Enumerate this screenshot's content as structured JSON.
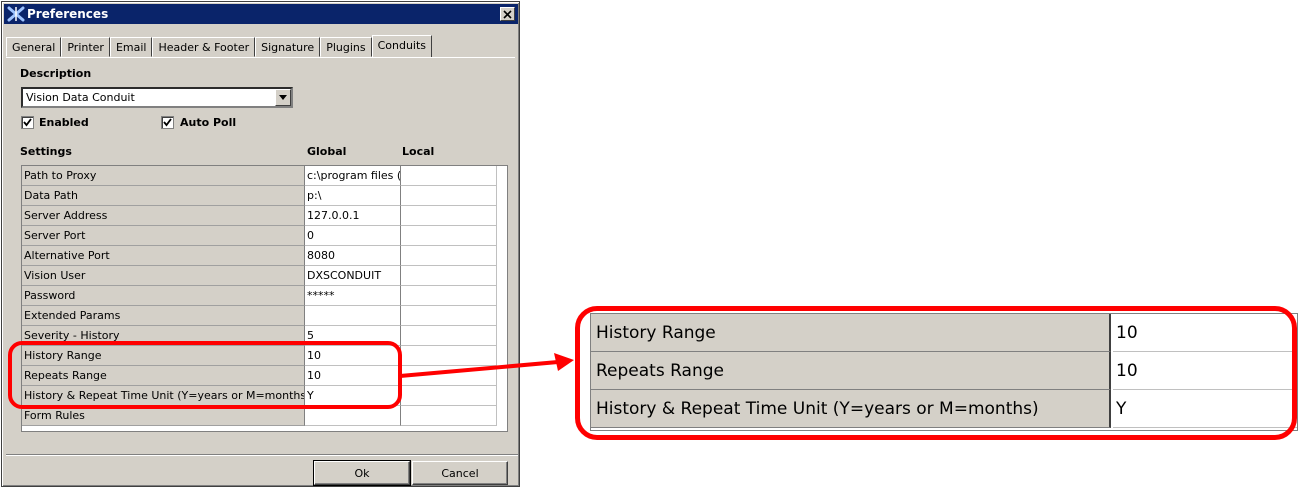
{
  "window": {
    "title": "Preferences",
    "close_glyph": "✕"
  },
  "tabs": [
    {
      "label": "General"
    },
    {
      "label": "Printer"
    },
    {
      "label": "Email"
    },
    {
      "label": "Header & Footer"
    },
    {
      "label": "Signature"
    },
    {
      "label": "Plugins"
    },
    {
      "label": "Conduits",
      "active": true
    }
  ],
  "description": {
    "label": "Description",
    "selected": "Vision Data Conduit"
  },
  "options": {
    "enabled": {
      "label": "Enabled",
      "checked": true
    },
    "auto_poll": {
      "label": "Auto Poll",
      "checked": true
    }
  },
  "settings": {
    "header_name": "Settings",
    "header_global": "Global",
    "header_local": "Local",
    "rows": [
      {
        "name": "Path to Proxy",
        "global": "c:\\program files (x",
        "local": ""
      },
      {
        "name": "Data Path",
        "global": "p:\\",
        "local": ""
      },
      {
        "name": "Server Address",
        "global": "127.0.0.1",
        "local": ""
      },
      {
        "name": "Server Port",
        "global": "0",
        "local": ""
      },
      {
        "name": "Alternative Port",
        "global": "8080",
        "local": ""
      },
      {
        "name": "Vision User",
        "global": "DXSCONDUIT",
        "local": ""
      },
      {
        "name": "Password",
        "global": "*****",
        "local": ""
      },
      {
        "name": "Extended Params",
        "global": "",
        "local": ""
      },
      {
        "name": "Severity - History",
        "global": "5",
        "local": ""
      },
      {
        "name": "History Range",
        "global": "10",
        "local": ""
      },
      {
        "name": "Repeats Range",
        "global": "10",
        "local": ""
      },
      {
        "name": "History & Repeat Time Unit (Y=years or M=months)",
        "global": "Y",
        "local": ""
      },
      {
        "name": "Form Rules",
        "global": "",
        "local": ""
      }
    ]
  },
  "buttons": {
    "ok": "Ok",
    "cancel": "Cancel"
  },
  "zoom": {
    "rows": [
      {
        "name": "History Range",
        "value": "10"
      },
      {
        "name": "Repeats Range",
        "value": "10"
      },
      {
        "name": "History & Repeat Time Unit (Y=years or M=months)",
        "value": "Y"
      }
    ]
  },
  "colors": {
    "highlight": "#ff0000",
    "titlebar": "#0a246a",
    "dialog_bg": "#d4d0c8"
  },
  "icons": {
    "app": "conduit-x-icon",
    "close": "close-icon",
    "dropdown": "chevron-down-icon",
    "check": "check-icon",
    "arrow": "arrow-right-icon"
  }
}
